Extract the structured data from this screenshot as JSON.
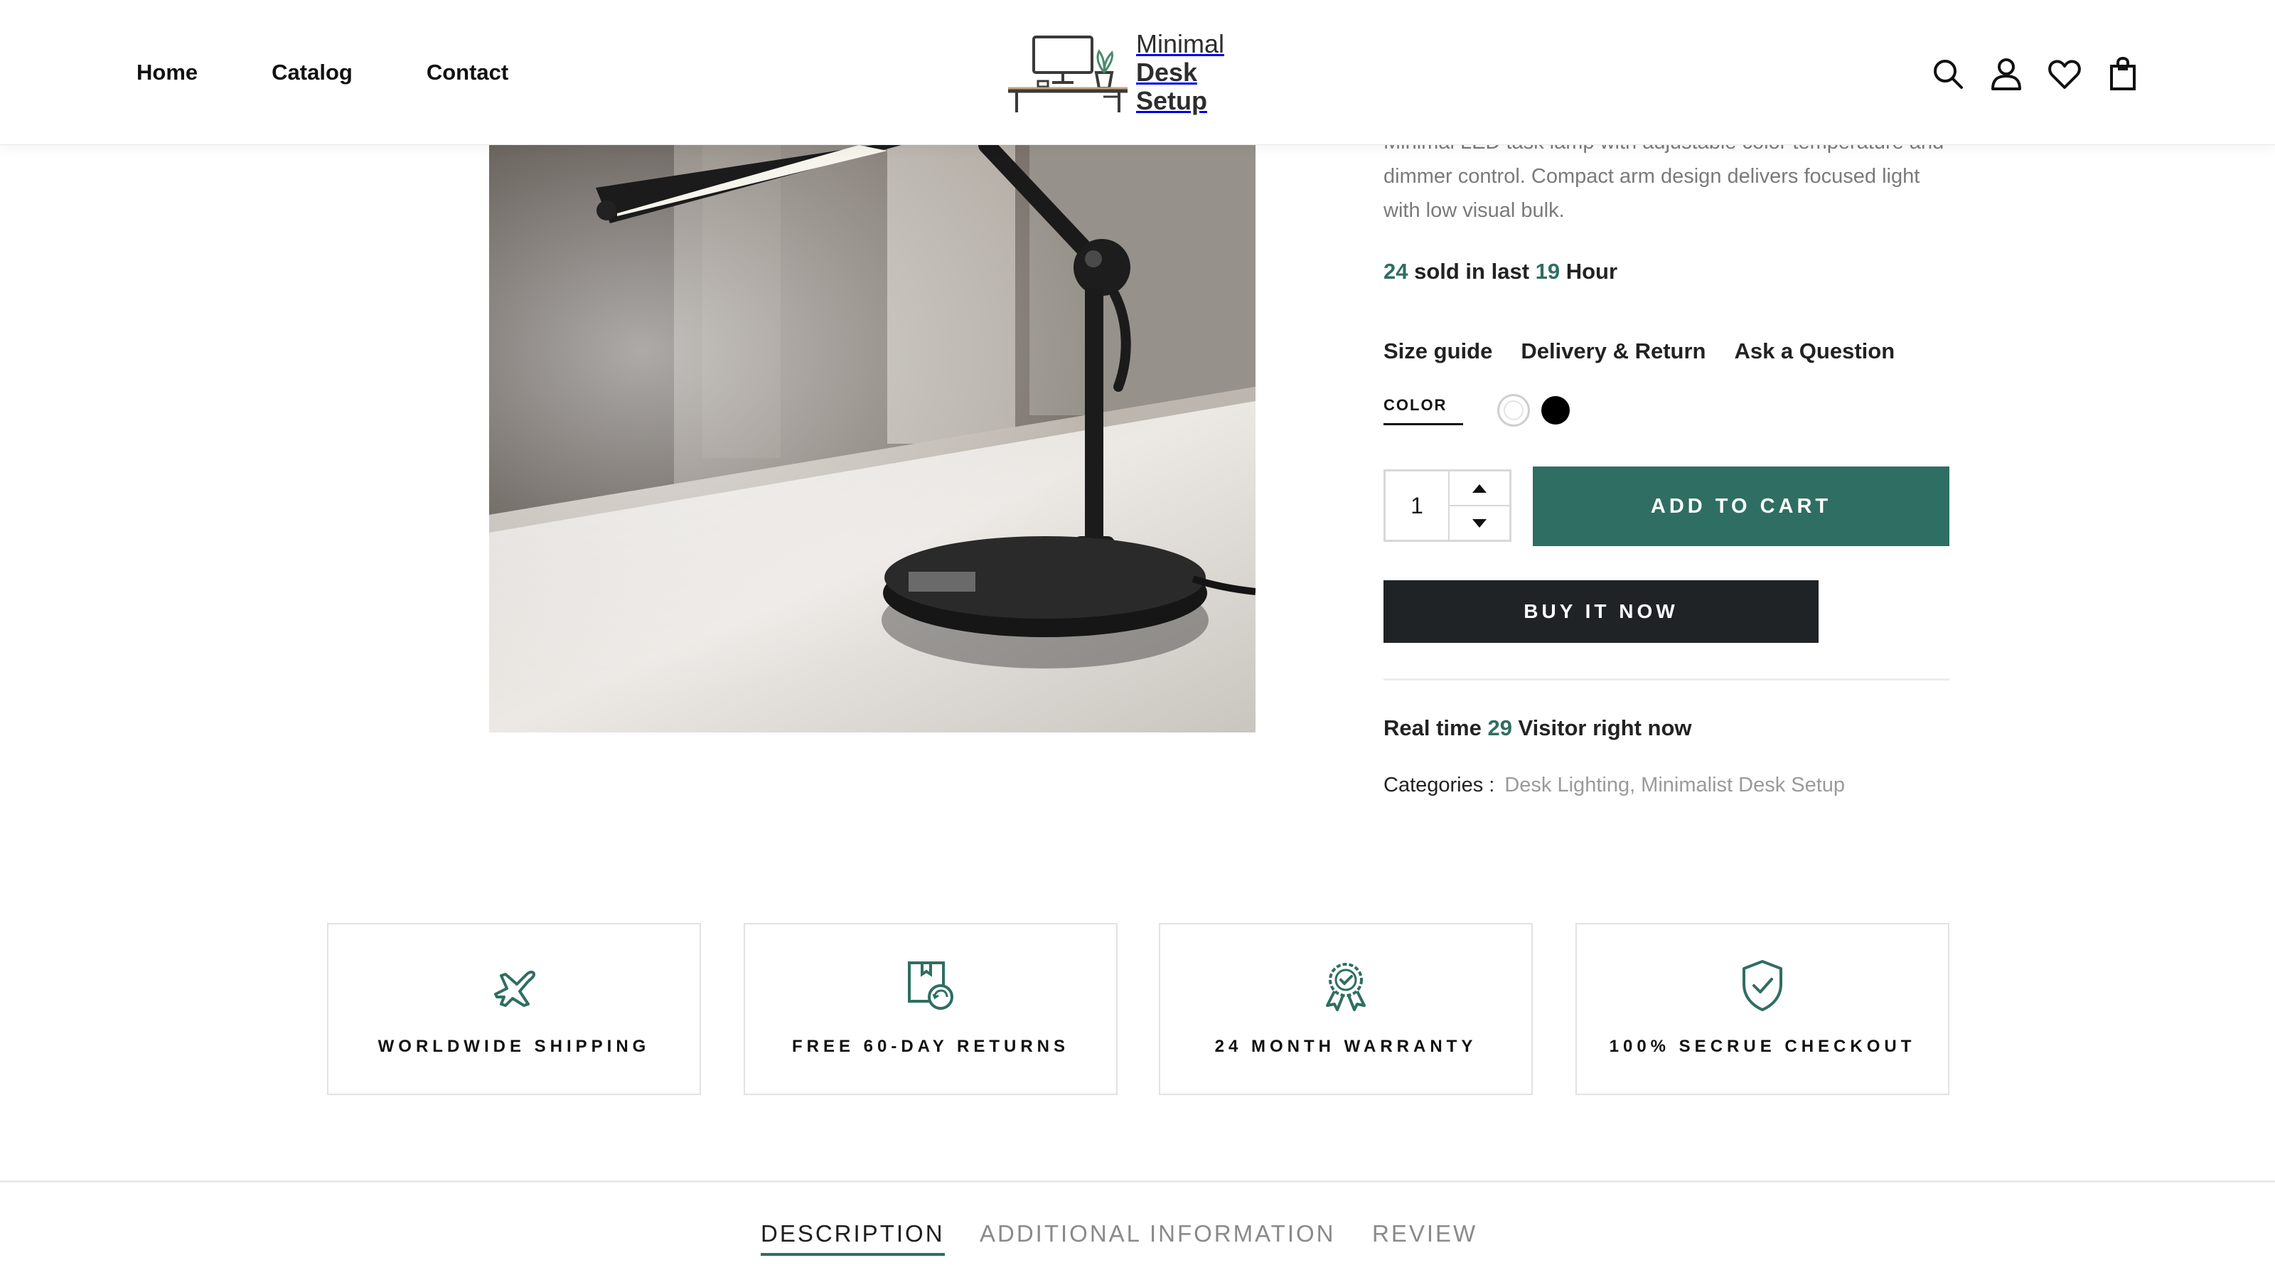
{
  "colors": {
    "accent": "#2f6e62",
    "dark_button": "#1f2326",
    "muted_text": "#7a7a7a",
    "category_link": "#9a9a9a"
  },
  "header": {
    "nav": [
      "Home",
      "Catalog",
      "Contact"
    ],
    "logo_line1": "Minimal",
    "logo_line2": "Desk Setup",
    "icons": [
      "search-icon",
      "user-icon",
      "heart-icon",
      "shopping-bag-icon"
    ]
  },
  "product": {
    "description": "Minimal LED task lamp with adjustable color temperature and dimmer control. Compact arm design delivers focused light with low visual bulk.",
    "sold_count": "24",
    "sold_mid": " sold in last ",
    "sold_hours": "19",
    "sold_suffix": " Hour",
    "links": [
      "Size guide",
      "Delivery & Return",
      "Ask a Question"
    ],
    "color_label": "COLOR",
    "colors": [
      "white",
      "black"
    ],
    "quantity": "1",
    "add_to_cart": "ADD TO CART",
    "buy_now": "BUY IT NOW",
    "visitors_prefix": "Real time ",
    "visitors_count": "29",
    "visitors_suffix": " Visitor right now",
    "categories_label": "Categories :",
    "categories": "Desk Lighting, Minimalist Desk Setup"
  },
  "features": [
    {
      "label": "WORLDWIDE SHIPPING",
      "icon": "airplane-icon"
    },
    {
      "label": "FREE 60-DAY RETURNS",
      "icon": "return-box-icon"
    },
    {
      "label": "24 MONTH WARRANTY",
      "icon": "award-badge-icon"
    },
    {
      "label": "100% SECRUE CHECKOUT",
      "icon": "shield-check-icon"
    }
  ],
  "tabs": [
    "DESCRIPTION",
    "ADDITIONAL INFORMATION",
    "REVIEW"
  ]
}
